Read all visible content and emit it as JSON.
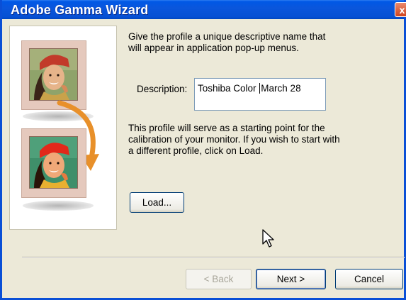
{
  "window": {
    "title": "Adobe Gamma Wizard",
    "close_label": "x"
  },
  "intro_text": "Give the profile a unique descriptive name that will appear in application pop-up menus.",
  "description": {
    "label": "Description:",
    "value_before_cursor": "Toshiba Color ",
    "value_after_cursor": "March 28"
  },
  "info_text": "This profile will serve as a starting point for the calibration of your monitor. If you wish to start with a different profile, click on Load.",
  "buttons": {
    "load": "Load...",
    "back": "< Back",
    "next": "Next >",
    "cancel": "Cancel"
  },
  "colors": {
    "title_bar": "#0a56dc",
    "dialog_bg": "#ece9d8",
    "frame": "#e5c9bd",
    "arrow": "#e8902a"
  }
}
